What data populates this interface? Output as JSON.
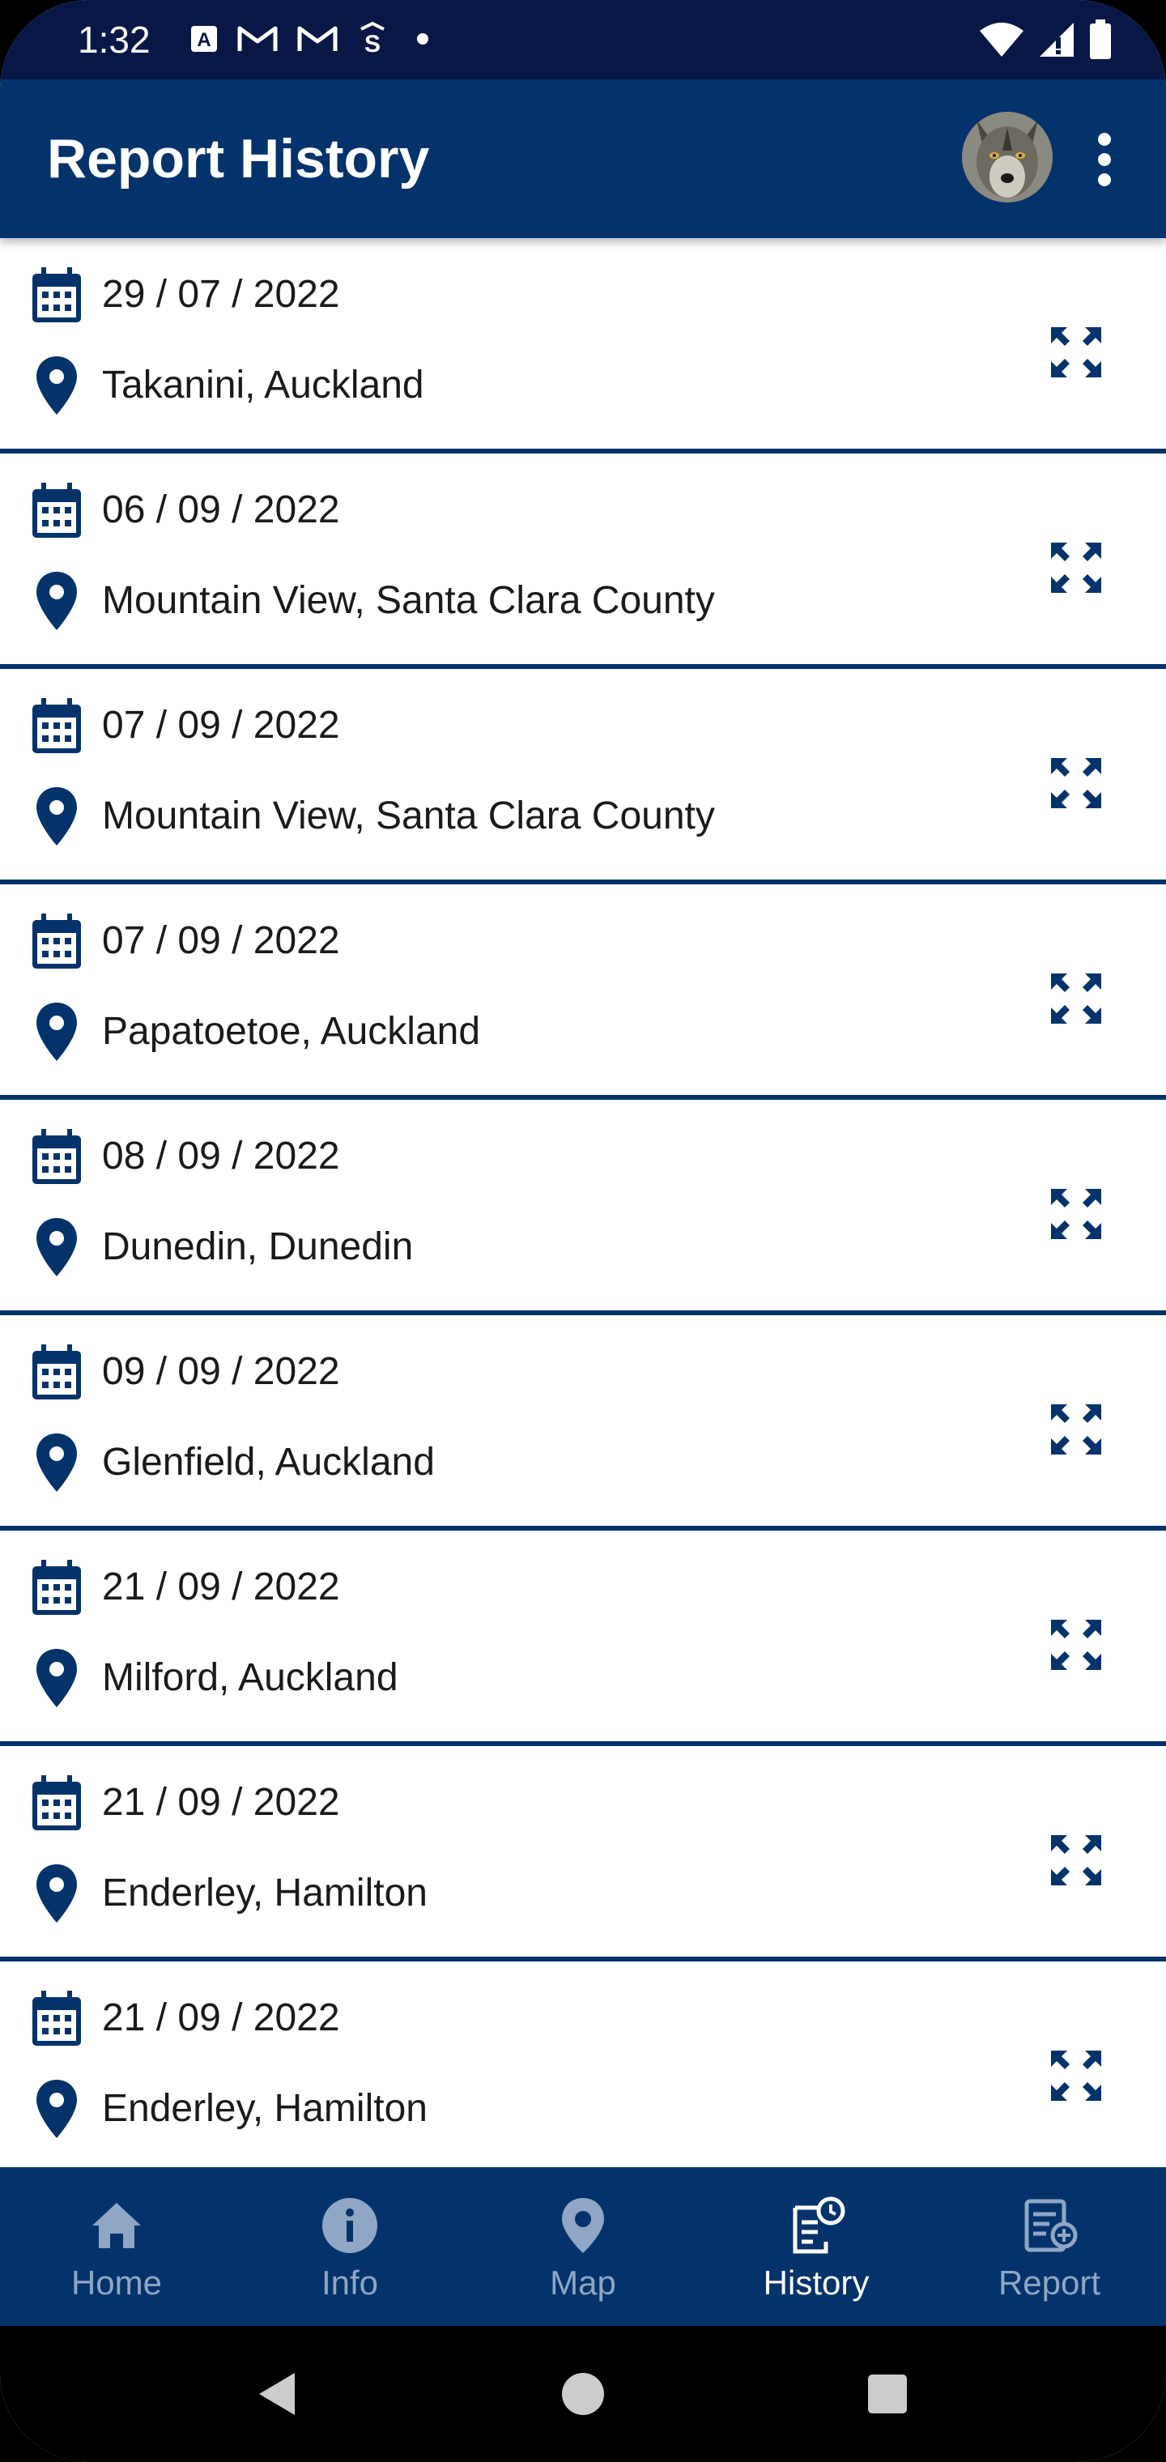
{
  "status_bar": {
    "time": "1:32",
    "notification_icons": [
      "accessibility-a-icon",
      "gmail-icon",
      "gmail-icon",
      "s-app-icon",
      "dot-icon"
    ],
    "right_icons": [
      "wifi-icon",
      "signal-icon",
      "battery-icon"
    ]
  },
  "app_bar": {
    "title": "Report History",
    "avatar": "wolf-avatar",
    "menu_icon": "more-vert-icon"
  },
  "reports": [
    {
      "date": "29 / 07 / 2022",
      "location": "Takanini, Auckland"
    },
    {
      "date": "06 / 09 / 2022",
      "location": "Mountain View, Santa Clara County"
    },
    {
      "date": "07 / 09 / 2022",
      "location": "Mountain View, Santa Clara County"
    },
    {
      "date": "07 / 09 / 2022",
      "location": "Papatoetoe, Auckland"
    },
    {
      "date": "08 / 09 / 2022",
      "location": "Dunedin, Dunedin"
    },
    {
      "date": "09 / 09 / 2022",
      "location": "Glenfield, Auckland"
    },
    {
      "date": "21 / 09 / 2022",
      "location": "Milford, Auckland"
    },
    {
      "date": "21 / 09 / 2022",
      "location": "Enderley, Hamilton"
    },
    {
      "date": "21 / 09 / 2022",
      "location": "Enderley, Hamilton"
    }
  ],
  "bottom_nav": {
    "items": [
      {
        "label": "Home",
        "icon": "home-icon"
      },
      {
        "label": "Info",
        "icon": "info-icon"
      },
      {
        "label": "Map",
        "icon": "map-pin-icon"
      },
      {
        "label": "History",
        "icon": "history-icon"
      },
      {
        "label": "Report",
        "icon": "report-add-icon"
      }
    ],
    "active": "History"
  },
  "system_nav": [
    "back-icon",
    "home-circle-icon",
    "recents-icon"
  ],
  "colors": {
    "primary": "#03336a",
    "status_bar": "#081746",
    "nav_inactive": "#8fa6c4",
    "nav_active": "#ffffff"
  }
}
